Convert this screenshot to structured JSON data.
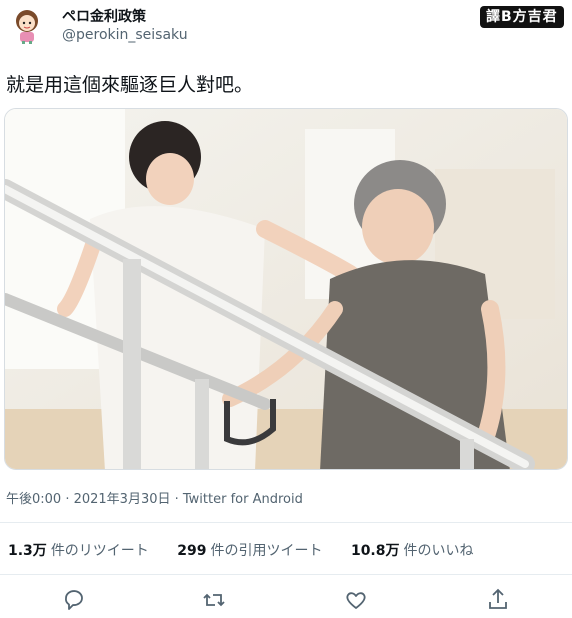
{
  "header": {
    "display_name": "ペロ金利政策",
    "handle": "@perokin_seisaku",
    "watermark": "譯B方吉君"
  },
  "tweet": {
    "text": "就是用這個來驅逐巨人對吧。",
    "meta": "午後0:00 · 2021年3月30日 · Twitter for Android"
  },
  "stats": {
    "retweets_count": "1.3万",
    "retweets_label": "件のリツイート",
    "quotes_count": "299",
    "quotes_label": "件の引用ツイート",
    "likes_count": "10.8万",
    "likes_label": "件のいいね"
  },
  "actions": {
    "icons": [
      "reply-icon",
      "retweet-icon",
      "like-icon",
      "share-icon"
    ]
  },
  "colors": {
    "text_primary": "#0f1419",
    "text_secondary": "#536471",
    "divider": "#e6ecf0"
  }
}
